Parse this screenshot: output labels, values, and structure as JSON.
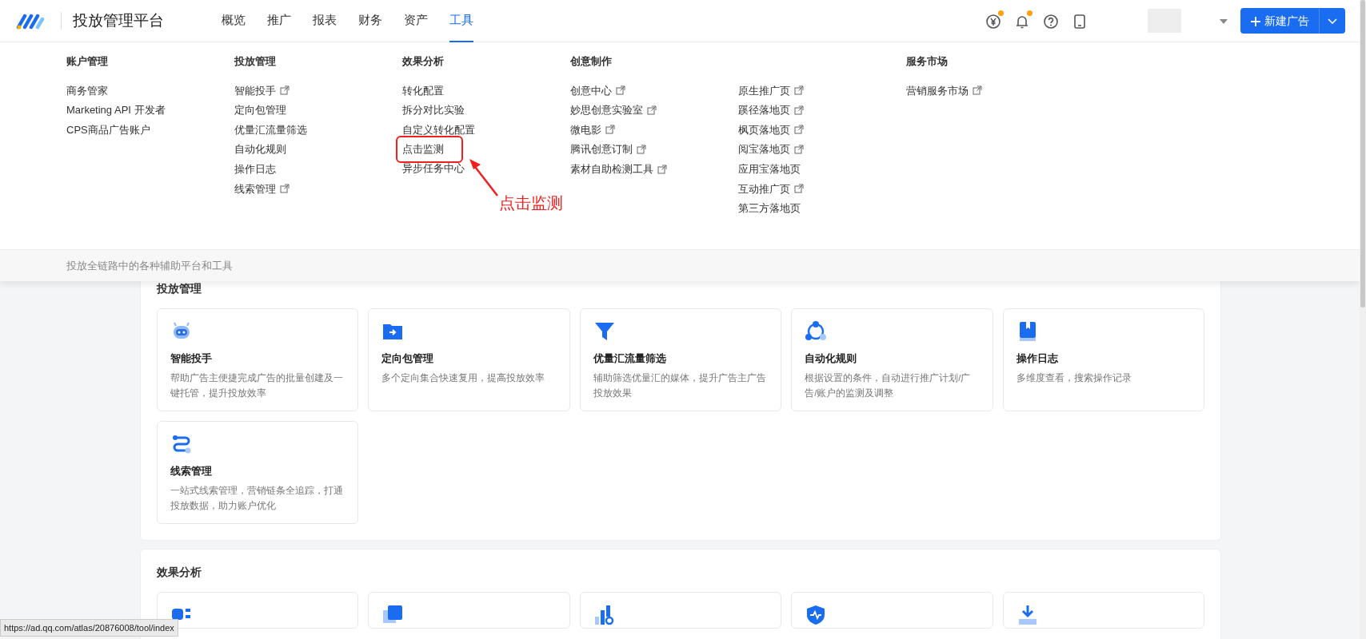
{
  "header": {
    "title": "投放管理平台",
    "nav": [
      {
        "label": "概览",
        "selected": false
      },
      {
        "label": "推广",
        "selected": false
      },
      {
        "label": "报表",
        "selected": false
      },
      {
        "label": "财务",
        "selected": false
      },
      {
        "label": "资产",
        "selected": false
      },
      {
        "label": "工具",
        "selected": true
      }
    ],
    "icons": [
      {
        "kind": "yen",
        "dot": true
      },
      {
        "kind": "bell",
        "dot": true
      },
      {
        "kind": "help",
        "dot": false
      },
      {
        "kind": "tablet",
        "dot": false
      }
    ],
    "new_button": "新建广告"
  },
  "tools_menu": {
    "columns": [
      {
        "heading": "账户管理",
        "items": [
          {
            "label": "商务管家",
            "external": false
          },
          {
            "label": "Marketing API 开发者",
            "external": false
          },
          {
            "label": "CPS商品广告账户",
            "external": false
          }
        ]
      },
      {
        "heading": "投放管理",
        "items": [
          {
            "label": "智能投手",
            "external": true
          },
          {
            "label": "定向包管理",
            "external": false
          },
          {
            "label": "优量汇流量筛选",
            "external": false
          },
          {
            "label": "自动化规则",
            "external": false
          },
          {
            "label": "操作日志",
            "external": false
          },
          {
            "label": "线索管理",
            "external": true
          }
        ]
      },
      {
        "heading": "效果分析",
        "items": [
          {
            "label": "转化配置",
            "external": false
          },
          {
            "label": "拆分对比实验",
            "external": false
          },
          {
            "label": "自定义转化配置",
            "external": false
          },
          {
            "label": "点击监测",
            "external": false,
            "highlighted": true
          },
          {
            "label": "异步任务中心",
            "external": false
          }
        ]
      },
      {
        "heading": "创意制作",
        "items": [
          {
            "label": "创意中心",
            "external": true
          },
          {
            "label": "妙思创意实验室",
            "external": true
          },
          {
            "label": "微电影",
            "external": true
          },
          {
            "label": "腾讯创意订制",
            "external": true
          },
          {
            "label": "素材自助检测工具",
            "external": true
          }
        ]
      },
      {
        "items": [
          {
            "label": "原生推广页",
            "external": true
          },
          {
            "label": "蹊径落地页",
            "external": true
          },
          {
            "label": "枫页落地页",
            "external": true
          },
          {
            "label": "阅宝落地页",
            "external": true
          },
          {
            "label": "应用宝落地页",
            "external": false
          },
          {
            "label": "互动推广页",
            "external": true
          },
          {
            "label": "第三方落地页",
            "external": false
          }
        ]
      },
      {
        "heading": "服务市场",
        "items": [
          {
            "label": "营销服务市场",
            "external": true
          }
        ]
      }
    ],
    "footer": "投放全链路中的各种辅助平台和工具"
  },
  "annotation": {
    "text": "点击监测"
  },
  "sections": [
    {
      "title": "投放管理",
      "cards": [
        {
          "kind": "robot",
          "title": "智能投手",
          "desc": "帮助广告主便捷完成广告的批量创建及一键托管，提升投放效率"
        },
        {
          "kind": "folder",
          "title": "定向包管理",
          "desc": "多个定向集合快速复用，提高投放效率"
        },
        {
          "kind": "funnel",
          "title": "优量汇流量筛选",
          "desc": "辅助筛选优量汇的媒体，提升广告主广告投放效果"
        },
        {
          "kind": "nodes",
          "title": "自动化规则",
          "desc": "根据设置的条件，自动进行推广计划/广告/账户的监测及调整"
        },
        {
          "kind": "book",
          "title": "操作日志",
          "desc": "多维度查看，搜索操作记录"
        },
        {
          "kind": "route",
          "title": "线索管理",
          "desc": "一站式线索管理，营销链条全追踪，打通投放数据，助力账户优化"
        }
      ]
    },
    {
      "title": "效果分析",
      "cards": [
        {
          "kind": "flow"
        },
        {
          "kind": "squares"
        },
        {
          "kind": "bars"
        },
        {
          "kind": "shield"
        },
        {
          "kind": "download"
        }
      ]
    }
  ],
  "status_url": "https://ad.qq.com/atlas/20876008/tool/index"
}
